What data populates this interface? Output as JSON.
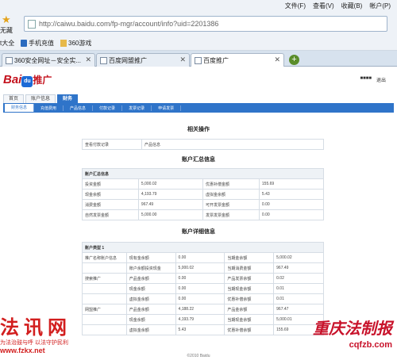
{
  "browser": {
    "menus": [
      "文件(F)",
      "查看(V)",
      "收藏(B)",
      "帐户(P)"
    ],
    "url": "http://caiwu.baidu.com/fp-mgr/account/info?uid=2201386",
    "favorites_label": "无藏",
    "bookmarks": [
      "t大全",
      "手机充值",
      "360游戏"
    ],
    "tabs": [
      "360安全网址－安全实...",
      "百度网盟推广",
      "百度推广"
    ]
  },
  "page": {
    "logo_text": "Bai",
    "logo_paw": "du",
    "logo_suffix": "推广",
    "user_links": [
      "■■■■",
      "退出"
    ],
    "nav": [
      "首页",
      "账户信息",
      "财务"
    ],
    "subnav": [
      "财务信息",
      "充值费用",
      "产品信息",
      "付款记录",
      "发票记录",
      "申请发票"
    ],
    "sections": {
      "related": "相关操作",
      "summary": "账户汇总信息",
      "detail": "账户详细信息"
    },
    "related_ops": [
      "查看付款记录",
      "产品信息"
    ],
    "summary_header": "账户汇总信息",
    "summary_rows": [
      [
        "投资金额",
        "5,000.02",
        "优惠补偿金额",
        "155.69"
      ],
      [
        "现金余额",
        "4,193.79",
        "虚拟金余额",
        "5.43"
      ],
      [
        "消费金额",
        "967.49",
        "可开发票金额",
        "0.00"
      ],
      [
        "自然发票金额",
        "5,000.00",
        "发票发票金额",
        "0.00"
      ]
    ],
    "detail_header": "账户类型 1",
    "detail_rows": [
      [
        "推广名称账户信息",
        "现有金余额",
        "0.00",
        "当期金余额",
        "5,000.02"
      ],
      [
        "",
        "账户余额投资现金",
        "5,000.02",
        "当期消费金额",
        "967.49"
      ],
      [
        "搜索推广",
        "产品金余额",
        "0.00",
        "产品发票余额",
        "0.02"
      ],
      [
        "",
        "现金余额",
        "0.00",
        "当期现金余额",
        "0.01"
      ],
      [
        "",
        "虚拟金余额",
        "0.00",
        "优惠补偿余额",
        "0.01"
      ],
      [
        "网盟推广",
        "产品金余额",
        "4,188.22",
        "产品金余额",
        "967.47"
      ],
      [
        "",
        "现金余额",
        "4,193.79",
        "当期现金余额",
        "5,000.01"
      ],
      [
        "",
        "虚拟金余额",
        "5.43",
        "优惠补偿余额",
        "155.69"
      ]
    ],
    "footer": "©2010 Baidu"
  },
  "watermarks": {
    "left_title": "法讯网",
    "left_slogan": "为法治鼓与呼 以法守护民利",
    "left_url": "www.fzkx.net",
    "right_brand": "重庆法制报",
    "right_domain": "cqfzb.com"
  }
}
